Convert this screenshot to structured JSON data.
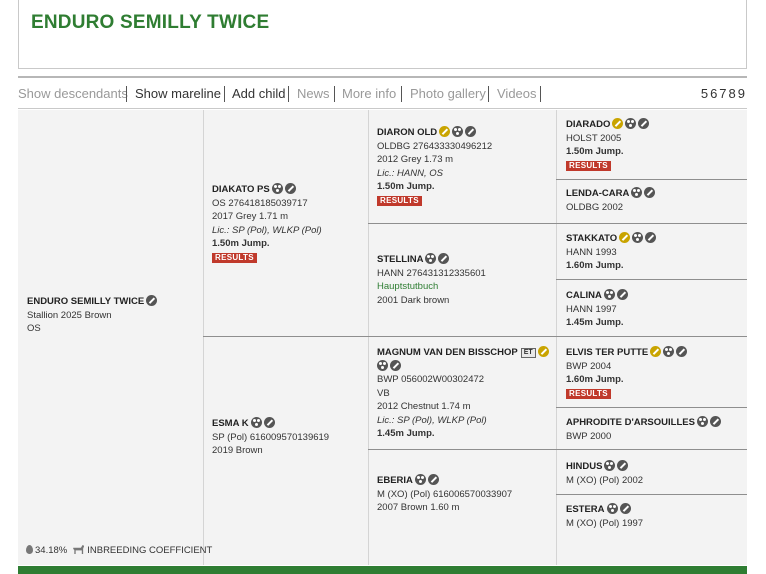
{
  "header": {
    "title": "ENDURO SEMILLY TWICE"
  },
  "tabs": [
    {
      "label": "Show descendants"
    },
    {
      "label": "Show mareline"
    },
    {
      "label": "Add child"
    },
    {
      "label": "News"
    },
    {
      "label": "More info"
    },
    {
      "label": "Photo gallery"
    },
    {
      "label": "Videos"
    }
  ],
  "pagination": "56789",
  "subject": {
    "name": "ENDURO SEMILLY TWICE",
    "line1": "Stallion 2025 Brown",
    "line2": "OS"
  },
  "sire": {
    "name": "DIAKATO PS",
    "reg": "OS 276418185039717",
    "desc": "2017 Grey 1.71 m",
    "lic": "Lic.: SP (Pol), WLKP (Pol)",
    "perf": "1.50m Jump.",
    "results": "RESULTS"
  },
  "dam": {
    "name": "ESMA K",
    "reg": "SP (Pol) 616009570139619",
    "desc": "2019 Brown"
  },
  "gen3": {
    "ss": {
      "name": "DIARON OLD",
      "reg": "OLDBG 276433330496212",
      "desc": "2012 Grey 1.73 m",
      "lic": "Lic.: HANN, OS",
      "perf": "1.50m Jump.",
      "results": "RESULTS"
    },
    "sd": {
      "name": "STELLINA",
      "reg": "HANN 276431312335601",
      "book": "Hauptstutbuch",
      "desc": "2001 Dark brown"
    },
    "ds": {
      "name": "MAGNUM VAN DEN BISSCHOP",
      "badge": "ET",
      "reg": "BWP 056002W00302472",
      "studbook": "VB",
      "desc": "2012 Chestnut 1.74 m",
      "lic": "Lic.: SP (Pol), WLKP (Pol)",
      "perf": "1.45m Jump."
    },
    "dd": {
      "name": "EBERIA",
      "reg": "M (XO) (Pol) 616006570033907",
      "desc": "2007 Brown 1.60 m"
    }
  },
  "gen4": {
    "sss": {
      "name": "DIARADO",
      "desc": "HOLST 2005",
      "perf": "1.50m Jump.",
      "results": "RESULTS"
    },
    "ssd": {
      "name": "LENDA-CARA",
      "desc": "OLDBG 2002"
    },
    "sds": {
      "name": "STAKKATO",
      "desc": "HANN 1993",
      "perf": "1.60m Jump."
    },
    "sdd": {
      "name": "CALINA",
      "desc": "HANN 1997",
      "perf": "1.45m Jump."
    },
    "dss": {
      "name": "ELVIS TER PUTTE",
      "desc": "BWP 2004",
      "perf": "1.60m Jump.",
      "results": "RESULTS"
    },
    "dsd": {
      "name": "APHRODITE D'ARSOUILLES",
      "desc": "BWP 2000"
    },
    "dds": {
      "name": "HINDUS",
      "desc": "M (XO) (Pol) 2002"
    },
    "ddd": {
      "name": "ESTERA",
      "desc": "M (XO) (Pol) 1997"
    }
  },
  "footer": {
    "inbreeding_value": "34.18%",
    "inbreeding_label": "INBREEDING COEFFICIENT"
  },
  "colors": {
    "brand_green": "#2e7d32",
    "results_red": "#c0392b",
    "gold_icon": "#c9a400"
  }
}
